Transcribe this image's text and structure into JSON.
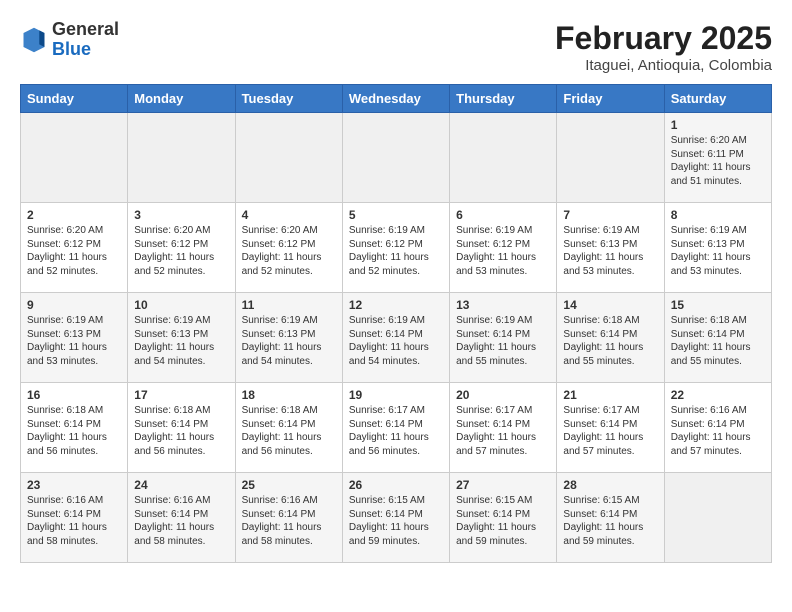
{
  "logo": {
    "general": "General",
    "blue": "Blue"
  },
  "title": {
    "month_year": "February 2025",
    "location": "Itaguei, Antioquia, Colombia"
  },
  "weekdays": [
    "Sunday",
    "Monday",
    "Tuesday",
    "Wednesday",
    "Thursday",
    "Friday",
    "Saturday"
  ],
  "weeks": [
    [
      {
        "day": "",
        "info": ""
      },
      {
        "day": "",
        "info": ""
      },
      {
        "day": "",
        "info": ""
      },
      {
        "day": "",
        "info": ""
      },
      {
        "day": "",
        "info": ""
      },
      {
        "day": "",
        "info": ""
      },
      {
        "day": "1",
        "info": "Sunrise: 6:20 AM\nSunset: 6:11 PM\nDaylight: 11 hours\nand 51 minutes."
      }
    ],
    [
      {
        "day": "2",
        "info": "Sunrise: 6:20 AM\nSunset: 6:12 PM\nDaylight: 11 hours\nand 52 minutes."
      },
      {
        "day": "3",
        "info": "Sunrise: 6:20 AM\nSunset: 6:12 PM\nDaylight: 11 hours\nand 52 minutes."
      },
      {
        "day": "4",
        "info": "Sunrise: 6:20 AM\nSunset: 6:12 PM\nDaylight: 11 hours\nand 52 minutes."
      },
      {
        "day": "5",
        "info": "Sunrise: 6:19 AM\nSunset: 6:12 PM\nDaylight: 11 hours\nand 52 minutes."
      },
      {
        "day": "6",
        "info": "Sunrise: 6:19 AM\nSunset: 6:12 PM\nDaylight: 11 hours\nand 53 minutes."
      },
      {
        "day": "7",
        "info": "Sunrise: 6:19 AM\nSunset: 6:13 PM\nDaylight: 11 hours\nand 53 minutes."
      },
      {
        "day": "8",
        "info": "Sunrise: 6:19 AM\nSunset: 6:13 PM\nDaylight: 11 hours\nand 53 minutes."
      }
    ],
    [
      {
        "day": "9",
        "info": "Sunrise: 6:19 AM\nSunset: 6:13 PM\nDaylight: 11 hours\nand 53 minutes."
      },
      {
        "day": "10",
        "info": "Sunrise: 6:19 AM\nSunset: 6:13 PM\nDaylight: 11 hours\nand 54 minutes."
      },
      {
        "day": "11",
        "info": "Sunrise: 6:19 AM\nSunset: 6:13 PM\nDaylight: 11 hours\nand 54 minutes."
      },
      {
        "day": "12",
        "info": "Sunrise: 6:19 AM\nSunset: 6:14 PM\nDaylight: 11 hours\nand 54 minutes."
      },
      {
        "day": "13",
        "info": "Sunrise: 6:19 AM\nSunset: 6:14 PM\nDaylight: 11 hours\nand 55 minutes."
      },
      {
        "day": "14",
        "info": "Sunrise: 6:18 AM\nSunset: 6:14 PM\nDaylight: 11 hours\nand 55 minutes."
      },
      {
        "day": "15",
        "info": "Sunrise: 6:18 AM\nSunset: 6:14 PM\nDaylight: 11 hours\nand 55 minutes."
      }
    ],
    [
      {
        "day": "16",
        "info": "Sunrise: 6:18 AM\nSunset: 6:14 PM\nDaylight: 11 hours\nand 56 minutes."
      },
      {
        "day": "17",
        "info": "Sunrise: 6:18 AM\nSunset: 6:14 PM\nDaylight: 11 hours\nand 56 minutes."
      },
      {
        "day": "18",
        "info": "Sunrise: 6:18 AM\nSunset: 6:14 PM\nDaylight: 11 hours\nand 56 minutes."
      },
      {
        "day": "19",
        "info": "Sunrise: 6:17 AM\nSunset: 6:14 PM\nDaylight: 11 hours\nand 56 minutes."
      },
      {
        "day": "20",
        "info": "Sunrise: 6:17 AM\nSunset: 6:14 PM\nDaylight: 11 hours\nand 57 minutes."
      },
      {
        "day": "21",
        "info": "Sunrise: 6:17 AM\nSunset: 6:14 PM\nDaylight: 11 hours\nand 57 minutes."
      },
      {
        "day": "22",
        "info": "Sunrise: 6:16 AM\nSunset: 6:14 PM\nDaylight: 11 hours\nand 57 minutes."
      }
    ],
    [
      {
        "day": "23",
        "info": "Sunrise: 6:16 AM\nSunset: 6:14 PM\nDaylight: 11 hours\nand 58 minutes."
      },
      {
        "day": "24",
        "info": "Sunrise: 6:16 AM\nSunset: 6:14 PM\nDaylight: 11 hours\nand 58 minutes."
      },
      {
        "day": "25",
        "info": "Sunrise: 6:16 AM\nSunset: 6:14 PM\nDaylight: 11 hours\nand 58 minutes."
      },
      {
        "day": "26",
        "info": "Sunrise: 6:15 AM\nSunset: 6:14 PM\nDaylight: 11 hours\nand 59 minutes."
      },
      {
        "day": "27",
        "info": "Sunrise: 6:15 AM\nSunset: 6:14 PM\nDaylight: 11 hours\nand 59 minutes."
      },
      {
        "day": "28",
        "info": "Sunrise: 6:15 AM\nSunset: 6:14 PM\nDaylight: 11 hours\nand 59 minutes."
      },
      {
        "day": "",
        "info": ""
      }
    ]
  ]
}
